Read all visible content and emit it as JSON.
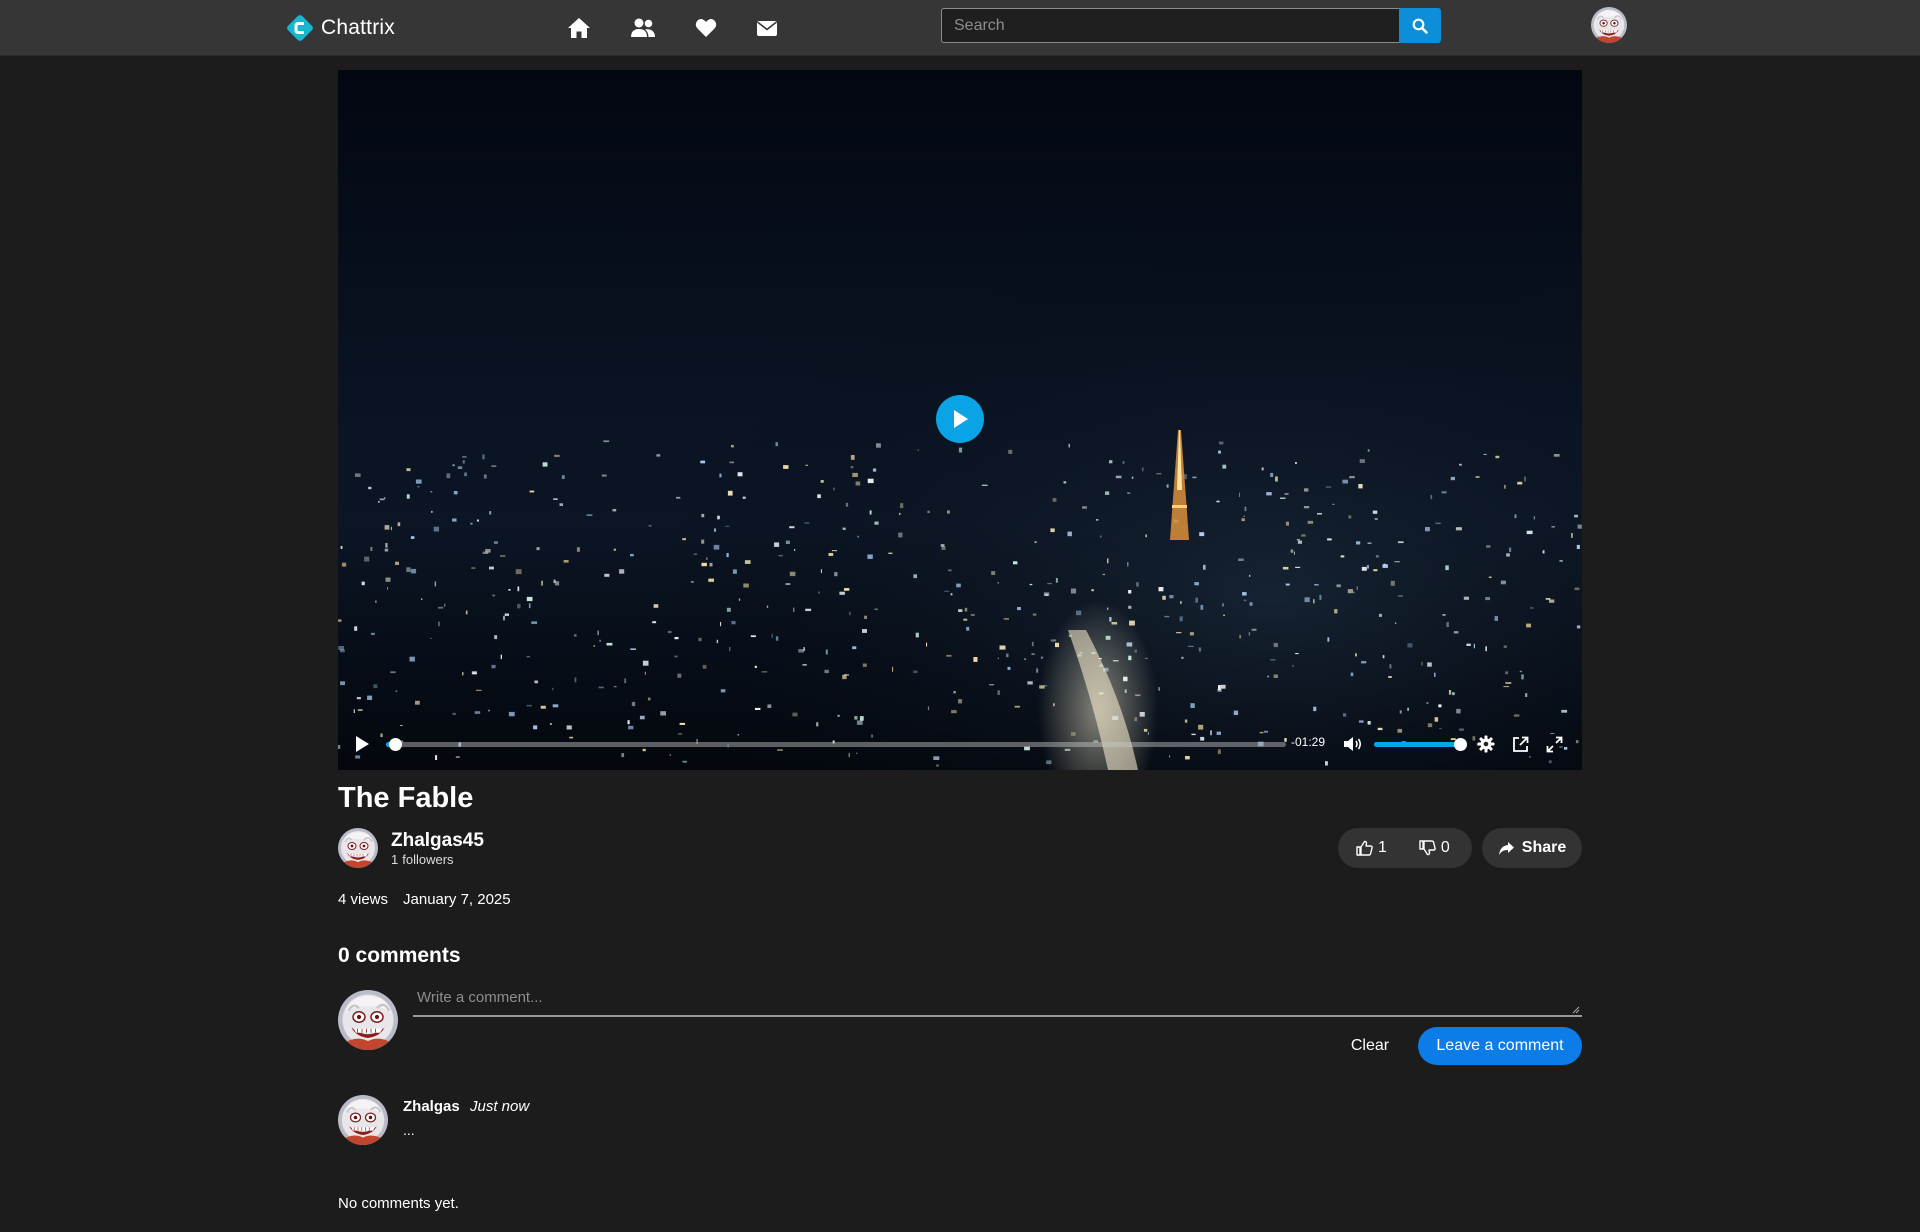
{
  "app": {
    "name": "Chattrix",
    "logo_icon": "chattrix-logo-icon",
    "brand_color": "#17b7d0"
  },
  "nav": {
    "icons": [
      "home-icon",
      "friends-icon",
      "favorites-icon",
      "messages-icon"
    ],
    "search": {
      "placeholder": "Search",
      "value": "",
      "button_icon": "search-icon",
      "button_color": "#0d8ed9"
    }
  },
  "video": {
    "current_time_remaining": "-01:29",
    "progress_fraction": 0.01,
    "volume_fraction": 1.0,
    "accent_color": "#0aa3e6",
    "controls": [
      "play-icon",
      "volume-icon",
      "settings-icon",
      "popout-icon",
      "fullscreen-icon"
    ]
  },
  "post": {
    "title": "The Fable",
    "author": {
      "name": "Zhalgas45",
      "followers_count": "1",
      "followers_label": "followers"
    },
    "likes": "1",
    "dislikes": "0",
    "share_label": "Share",
    "views": "4 views",
    "date": "January 7, 2025"
  },
  "comments": {
    "header": "0 comments",
    "input_placeholder": "Write a comment...",
    "clear_label": "Clear",
    "submit_label": "Leave a comment",
    "submit_color": "#0b7ce8",
    "pending": {
      "author": "Zhalgas",
      "time": "Just now",
      "text": "..."
    },
    "empty_message": "No comments yet."
  }
}
